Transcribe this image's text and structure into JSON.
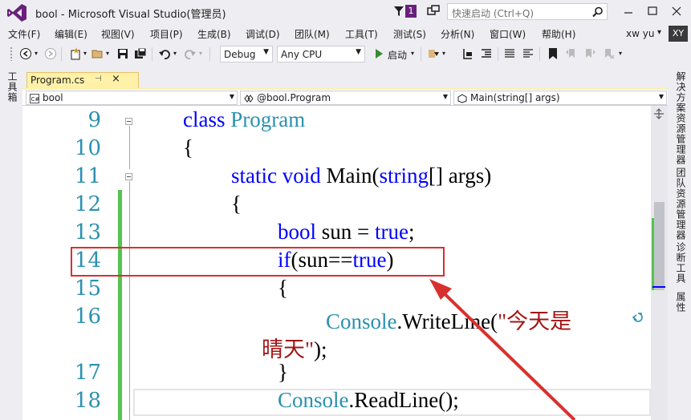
{
  "window": {
    "title": "bool - Microsoft Visual Studio(管理员)",
    "notification_count": "1",
    "quick_launch_placeholder": "快速启动 (Ctrl+Q)",
    "user_name": "xw yu",
    "user_initials": "XY"
  },
  "menu": [
    "文件(F)",
    "编辑(E)",
    "视图(V)",
    "项目(P)",
    "生成(B)",
    "调试(D)",
    "团队(M)",
    "工具(T)",
    "测试(S)",
    "分析(N)",
    "窗口(W)",
    "帮助(H)"
  ],
  "toolbar": {
    "configuration": "Debug",
    "platform": "Any CPU",
    "start_label": "启动"
  },
  "left_panel": {
    "toolbox_label": "工具箱"
  },
  "right_panel": {
    "tabs": [
      "解决方案资源管理器",
      "团队资源管理器",
      "诊断工具",
      "属性"
    ]
  },
  "document": {
    "tab_name": "Program.cs",
    "nav_project": "bool",
    "nav_class": "@bool.Program",
    "nav_member": "Main(string[] args)"
  },
  "code": {
    "line_numbers": [
      "9",
      "10",
      "11",
      "12",
      "13",
      "14",
      "15",
      "16",
      "",
      "17",
      "18"
    ],
    "l9_kw": "class",
    "l9_type": "Program",
    "l10": "{",
    "l11_kw1": "static",
    "l11_kw2": "void",
    "l11_name": "Main(",
    "l11_kw3": "string",
    "l11_rest": "[] args)",
    "l12": "{",
    "l13_kw": "bool",
    "l13_mid": "sun = ",
    "l13_kw2": "true",
    "l13_end": ";",
    "l14_kw": "if",
    "l14_mid": "(sun==",
    "l14_kw2": "true",
    "l14_end": ")",
    "l15": "{",
    "l16_type": "Console",
    "l16_call": ".WriteLine(",
    "l16_str": "\"今天是",
    "l16b_str": "晴天\"",
    "l16b_end": ");",
    "l17": "}",
    "l18_type": "Console",
    "l18_call": ".ReadLine();"
  },
  "colors": {
    "accent_purple": "#68217a",
    "keyword": "#0000ff",
    "type": "#2b91af",
    "string": "#a31515",
    "change_bar": "#57c350",
    "annotation_red": "#d8302f"
  }
}
